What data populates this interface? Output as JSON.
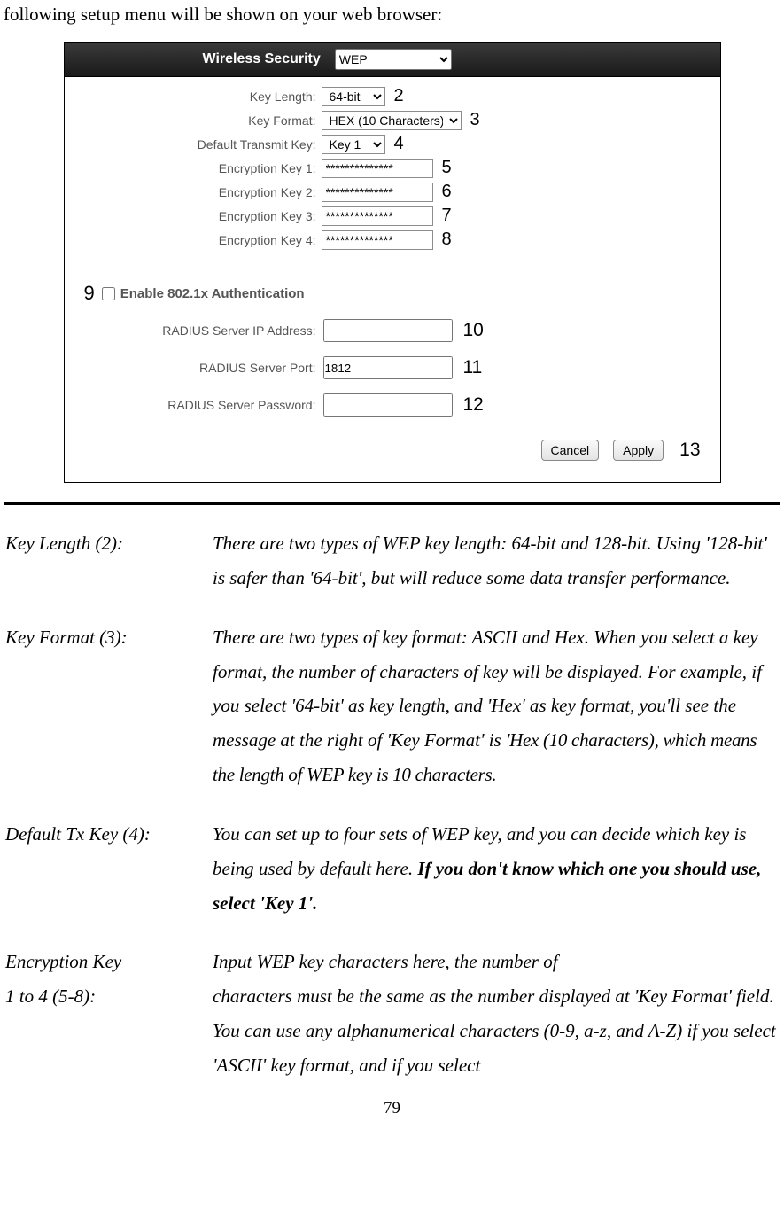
{
  "intro": "following setup menu will be shown on your web browser:",
  "screenshot": {
    "title": "Wireless Security",
    "securitySelect": "WEP",
    "rows": {
      "keyLength": {
        "label": "Key Length:",
        "value": "64-bit",
        "annot": "2"
      },
      "keyFormat": {
        "label": "Key Format:",
        "value": "HEX (10 Characters)",
        "annot": "3"
      },
      "defaultTx": {
        "label": "Default Transmit Key:",
        "value": "Key 1",
        "annot": "4"
      },
      "enc1": {
        "label": "Encryption Key 1:",
        "value": "**************",
        "annot": "5"
      },
      "enc2": {
        "label": "Encryption Key 2:",
        "value": "**************",
        "annot": "6"
      },
      "enc3": {
        "label": "Encryption Key 3:",
        "value": "**************",
        "annot": "7"
      },
      "enc4": {
        "label": "Encryption Key 4:",
        "value": "**************",
        "annot": "8"
      }
    },
    "enable": {
      "annot": "9",
      "label": "Enable 802.1x Authentication"
    },
    "radius": {
      "ip": {
        "label": "RADIUS Server IP Address:",
        "value": "",
        "annot": "10"
      },
      "port": {
        "label": "RADIUS Server Port:",
        "value": "1812",
        "annot": "11"
      },
      "pwd": {
        "label": "RADIUS Server Password:",
        "value": "",
        "annot": "12"
      }
    },
    "buttons": {
      "cancel": "Cancel",
      "apply": "Apply",
      "annot": "13"
    }
  },
  "defs": {
    "keyLength": {
      "term": "Key Length (2):",
      "body": "There are two types of WEP key length: 64-bit and 128-bit. Using '128-bit' is safer than '64-bit', but will reduce some data transfer performance."
    },
    "keyFormat": {
      "term": "Key Format (3):",
      "body1": "There are two types of key format: ASCII and Hex. When you select a key format, the number of characters of key will be displayed. For example, if you select '64-bit' as key length, and 'Hex' as key format, you'll see the message at the right of 'Key Format' is ",
      "body2": "'Hex (10 characters), which means the length of WEP key is 10 characters."
    },
    "defaultTx": {
      "term": "Default Tx Key (4):",
      "body1": "You can set up to four sets of WEP key, and you can decide which key is being used by default here. ",
      "bold": "If you don't know which one you should use, select 'Key 1'."
    },
    "encKey": {
      "term1": "Encryption Key",
      "term2": "1 to 4 (5-8):",
      "line1": "Input WEP key characters here, the number of",
      "body": "characters must be the same as the number displayed at 'Key Format' field. You can use any alphanumerical characters (0-9, a-z, and A-Z) if you select 'ASCII' key format, and if you select"
    }
  },
  "pageNum": "79"
}
